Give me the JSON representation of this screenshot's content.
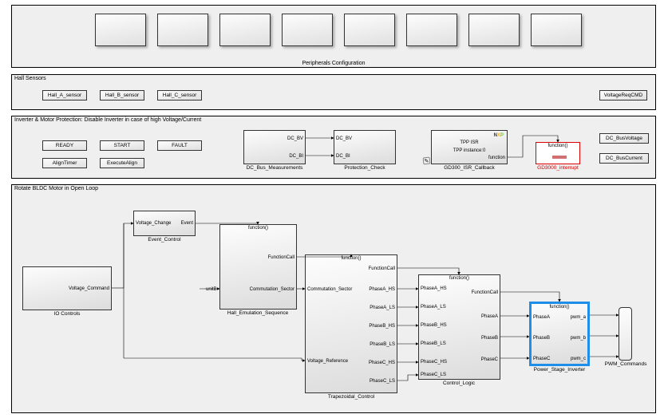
{
  "peripherals": {
    "title": "Peripherals Configuration"
  },
  "hall": {
    "title": "Hall Sensors",
    "buttons": [
      "Hall_A_sensor",
      "Hall_B_sensor",
      "Hall_C_sensor"
    ],
    "voltageReq": "VoltageReqCMD"
  },
  "protection": {
    "title": "Inverter & Motor Protection: Disable Inverter in case of high Voltage/Current",
    "buttons_row1": [
      "READY",
      "START",
      "FAULT"
    ],
    "buttons_row2": [
      "AlignTimer",
      "ExecuteAlign"
    ],
    "dc_bus": {
      "label": "DC_Bus_Measurements",
      "out1": "DC_BV",
      "out2": "DC_BI"
    },
    "prot_check": {
      "label": "Protection_Check",
      "in1": "DC_BV",
      "in2": "DC_BI"
    },
    "isr": {
      "label": "GD300_ISR_Callback",
      "line1": "TPP ISR",
      "line2": "TPP instance:0",
      "out": "function"
    },
    "interrupt": {
      "label": "GD3000_interrupt",
      "top": "function()"
    },
    "buttons_right": [
      "DC_BusVoltage",
      "DC_BusCurrent"
    ]
  },
  "rotate": {
    "title": "Rotate BLDC Motor in Open Loop",
    "io_controls": {
      "label": "IO Controls",
      "out": "Voltage_Command"
    },
    "event_control": {
      "label": "Event_Control",
      "in": "Voltage_Change",
      "out": "Event"
    },
    "hall_emul": {
      "label": "Hall_Emulation_Sequence",
      "top": "function()",
      "mid": "FunctionCall",
      "out1": "Commutation_Sector",
      "out2": "unitB"
    },
    "trapezoidal": {
      "label": "Trapezoidal_Control",
      "top": "function()",
      "in1": "Commutation_Sector",
      "in2": "Voltage_Reference",
      "out_fc": "FunctionCall",
      "outs": [
        "PhaseA_HS",
        "PhaseA_LS",
        "PhaseB_HS",
        "PhaseB_LS",
        "PhaseC_HS",
        "PhaseC_LS"
      ]
    },
    "control_logic": {
      "label": "Control_Logic",
      "top": "function()",
      "ins": [
        "PhaseA_HS",
        "PhaseA_LS",
        "PhaseB_HS",
        "PhaseB_LS",
        "PhaseC_HS",
        "PhaseC_LS"
      ],
      "out_fc": "FunctionCall",
      "outs": [
        "PhaseA",
        "PhaseB",
        "PhaseC"
      ]
    },
    "power_stage": {
      "label": "Power_Stage_Inverter",
      "top": "function()",
      "ins": [
        "PhaseA",
        "PhaseB",
        "PhaseC"
      ],
      "outs": [
        "pwm_a",
        "pwm_b",
        "pwm_c"
      ]
    },
    "pwm": {
      "label": "PWM_Commands"
    }
  }
}
